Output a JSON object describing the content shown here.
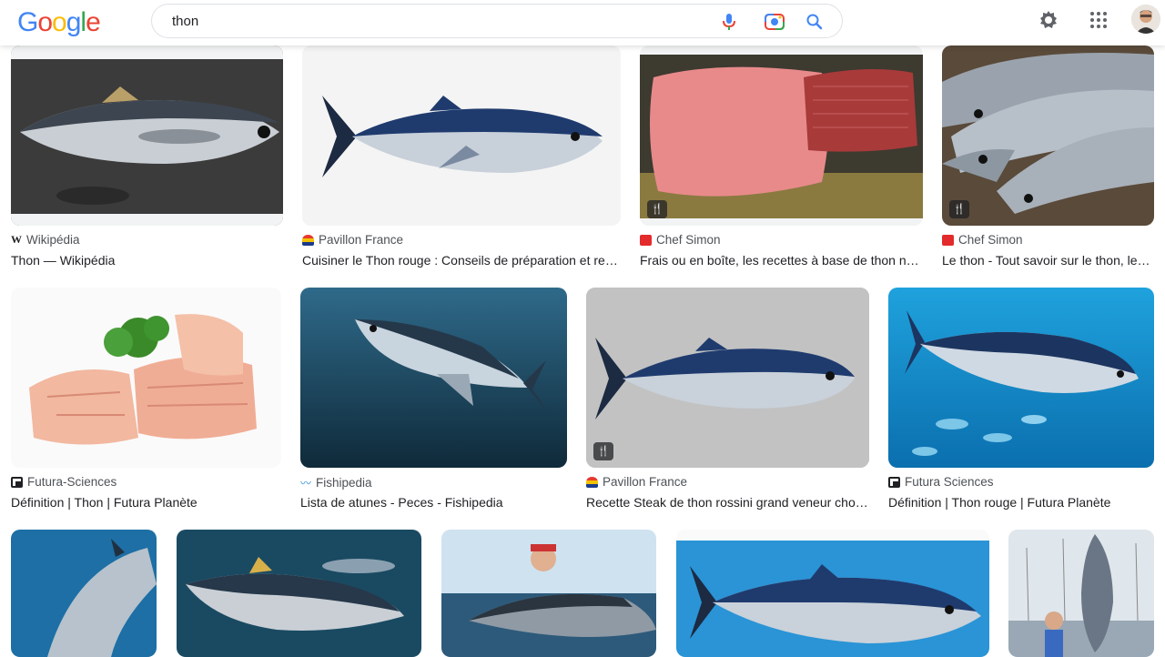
{
  "header": {
    "logo_letters": [
      "G",
      "o",
      "o",
      "g",
      "l",
      "e"
    ],
    "logo_colors": [
      "#4285F4",
      "#EA4335",
      "#FBBC05",
      "#4285F4",
      "#34A853",
      "#EA4335"
    ],
    "query": "thon",
    "icons": [
      "mic-icon",
      "camera-lens-icon",
      "search-icon",
      "gear-icon",
      "apps-grid-icon",
      "avatar"
    ]
  },
  "results": [
    {
      "source": "Wikipédia",
      "title": "Thon — Wikipédia",
      "favicon": "W",
      "recipe_badge": false
    },
    {
      "source": "Pavillon France",
      "title": "Cuisiner le Thon rouge : Conseils de préparation et rec...",
      "favicon": "pavillon",
      "recipe_badge": false
    },
    {
      "source": "Chef Simon",
      "title": "Frais ou en boîte, les recettes à base de thon ne ...",
      "favicon": "red",
      "recipe_badge": true
    },
    {
      "source": "Chef Simon",
      "title": "Le thon - Tout savoir sur le thon, les...",
      "favicon": "red",
      "recipe_badge": true
    },
    {
      "source": "Futura-Sciences",
      "title": "Définition | Thon | Futura Planète",
      "favicon": "futura",
      "recipe_badge": false
    },
    {
      "source": "Fishipedia",
      "title": "Lista de atunes - Peces - Fishipedia",
      "favicon": "fishipedia",
      "recipe_badge": false
    },
    {
      "source": "Pavillon France",
      "title": "Recette Steak de thon rossini grand veneur choc...",
      "favicon": "pavillon",
      "recipe_badge": true
    },
    {
      "source": "Futura Sciences",
      "title": "Définition | Thon rouge | Futura Planète",
      "favicon": "futura",
      "recipe_badge": false
    }
  ]
}
